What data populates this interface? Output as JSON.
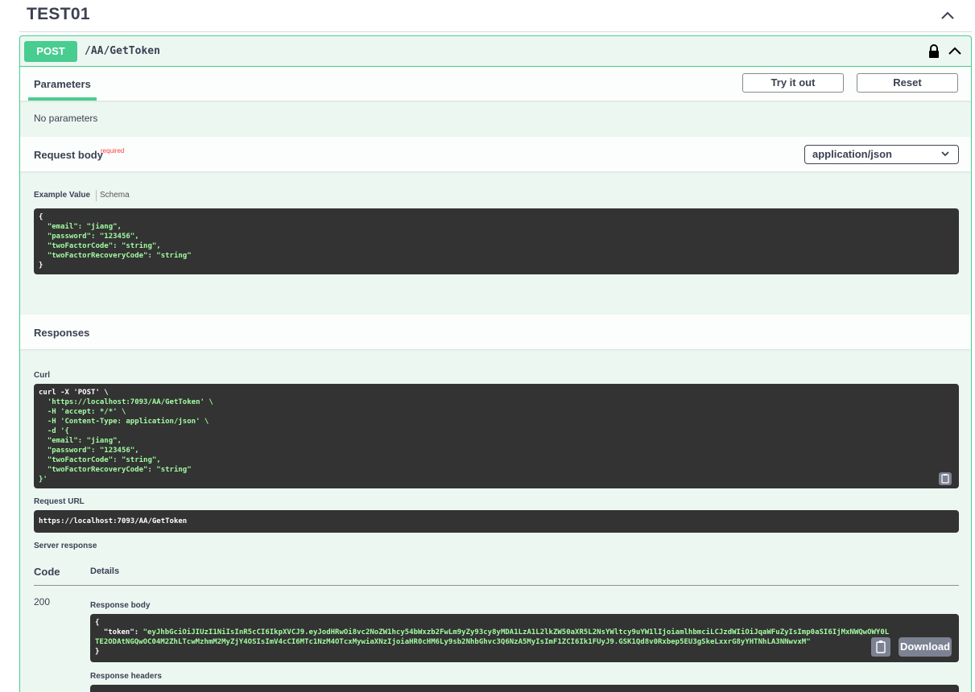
{
  "tag": {
    "title": "TEST01"
  },
  "operation": {
    "method": "POST",
    "path": "/AA/GetToken",
    "colors": {
      "accent": "#49cc90",
      "background": "#edf7f2"
    }
  },
  "parameters": {
    "tab_label": "Parameters",
    "try_it_out_label": "Try it out",
    "reset_label": "Reset",
    "no_params_text": "No parameters"
  },
  "request_body": {
    "title": "Request body",
    "required_label": "required",
    "content_type": "application/json",
    "example_tab": "Example Value",
    "schema_tab": "Schema",
    "example_lines": [
      "{",
      "  \"email\": \"jiang\",",
      "  \"password\": \"123456\",",
      "  \"twoFactorCode\": \"string\",",
      "  \"twoFactorRecoveryCode\": \"string\"",
      "}"
    ]
  },
  "responses": {
    "title": "Responses",
    "curl_label": "Curl",
    "curl_lines": [
      "curl -X 'POST' \\",
      "  'https://localhost:7093/AA/GetToken' \\",
      "  -H 'accept: */*' \\",
      "  -H 'Content-Type: application/json' \\",
      "  -d '{",
      "  \"email\": \"jiang\",",
      "  \"password\": \"123456\",",
      "  \"twoFactorCode\": \"string\",",
      "  \"twoFactorRecoveryCode\": \"string\"",
      "}'"
    ],
    "request_url_label": "Request URL",
    "request_url": "https://localhost:7093/AA/GetToken",
    "server_response_label": "Server response",
    "code_header": "Code",
    "details_header": "Details",
    "status_code": "200",
    "response_body_label": "Response body",
    "response_body_line1": "{",
    "response_token_key": "  \"token\": ",
    "response_token_part1": "\"eyJhbGciOiJIUzI1NiIsInR5cCI6IkpXVCJ9.eyJodHRwOi8vc2NoZW1hcy54bWxzb2FwLm9yZy93cy8yMDA1LzA1L2lkZW50aXR5L2NsYWltcy9uYW1lIjoiamlhbmciLCJzdWIiOiJqaWFuZyIsImp0aSI6IjMxNWQwOWY0LTE2ODAtNGQwOC04M2ZhLTcwMzhmM2MyZjY4OSIsImV4cCI6MTc1NzM4OTcxMywiaXNzIjoiaHR0cHM6Ly9sb2NhbGhvc3Q6NzA5MyIsImF1ZCI6Ik1FUyJ9.GSK1Qd8v0Rxbep5EU3gSkeLxxrG8yYHTNhLA3NNwvxM\"",
    "response_body_line3": "}",
    "download_label": "Download",
    "response_headers_label": "Response headers"
  }
}
